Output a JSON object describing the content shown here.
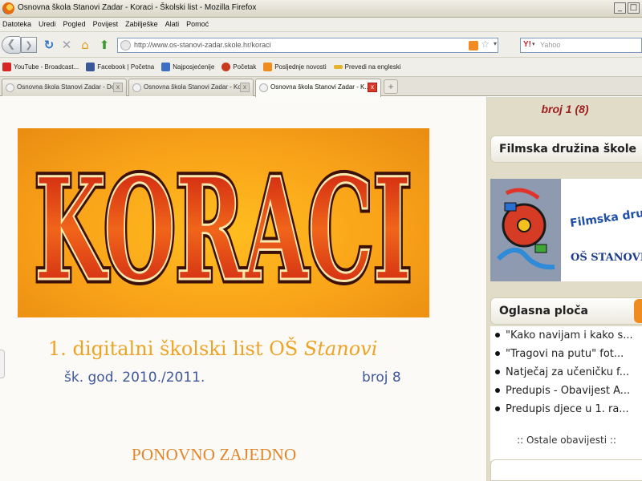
{
  "window": {
    "title": "Osnovna škola Stanovi Zadar - Koraci - Školski list - Mozilla Firefox",
    "min_label": "_",
    "max_label": "□"
  },
  "menu": [
    "Datoteka",
    "Uredi",
    "Pogled",
    "Povijest",
    "Zabilješke",
    "Alati",
    "Pomoć"
  ],
  "nav": {
    "back_icon": "back-arrow-icon",
    "back_glyph": "❮",
    "forward_glyph": "❯",
    "reload_glyph": "↻",
    "stop_glyph": "✕",
    "home_glyph": "⌂",
    "bookmark_glyph": "⬆",
    "url": "http://www.os-stanovi-zadar.skole.hr/koraci",
    "star_glyph": "☆",
    "dropdown_glyph": "▾",
    "search_placeholder": "Yahoo",
    "search_engine_glyph": "Y!",
    "search_engine_arrow": "▾"
  },
  "bookmarks": [
    {
      "label": "YouTube - Broadcast...",
      "icon": "youtube-icon",
      "color": "#d82624"
    },
    {
      "label": "Facebook | Početna",
      "icon": "facebook-icon",
      "color": "#3b5998"
    },
    {
      "label": "Najposjećenije",
      "icon": "most-visited-icon",
      "color": "#3d6fc2"
    },
    {
      "label": "Početak",
      "icon": "getting-started-icon",
      "color": "#c73a1d"
    },
    {
      "label": "Posljednje novosti",
      "icon": "rss-icon",
      "color": "#f08c1f"
    },
    {
      "label": "Prevedi na engleski",
      "icon": "translate-icon",
      "color": "#e6b42c"
    }
  ],
  "tabs": [
    {
      "label": "Osnovna škola Stanovi Zadar - Dobrod...",
      "active": false
    },
    {
      "label": "Osnovna škola Stanovi Zadar - Koraci - ...",
      "active": false
    },
    {
      "label": "Osnovna škola Stanovi Zadar - K...",
      "active": true
    }
  ],
  "new_tab_glyph": "+",
  "tab_close_glyph": "x",
  "page": {
    "logo_text": "KORACI",
    "subtitle_main": "1. digitalni školski list OŠ ",
    "subtitle_italic": "Stanovi",
    "school_year": "šk. god. 2010./2011.",
    "issue": "broj  8",
    "headline": "PONOVNO ZAJEDNO"
  },
  "sidebar": {
    "issue": "broj 1 (8)",
    "film_title": "Filmska družina škole",
    "film_image_text_1": "Filmska družina",
    "film_image_text_2": "OŠ  STANOVI",
    "board_title": "Oglasna ploča",
    "notices": [
      "\"Kako navijam i kako s...",
      "\"Tragovi na putu\" fot...",
      "Natječaj za učeničku f...",
      "Predupis - Obavijest A...",
      "Predupis djece u 1. ra..."
    ],
    "more": ":: Ostale obavijesti ::"
  },
  "colors": {
    "logo_red": "#cc1d17",
    "logo_orange": "#f9a319",
    "subtitle": "#eda325",
    "year_blue": "#40589a",
    "issue_red": "#9b1c1c",
    "sidebar_bg": "#e1dcc8"
  }
}
